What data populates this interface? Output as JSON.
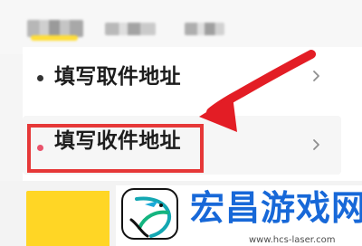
{
  "address_list": {
    "pickup_label": "填写取件地址",
    "delivery_label": "填写收件地址"
  },
  "watermark": {
    "brand": "宏昌游戏网",
    "url": "www.hcs-laser.com"
  },
  "colors": {
    "accent_yellow": "#ffd625",
    "highlight_red": "#e63838",
    "delivery_dot": "#e9536b",
    "watermark_blue": "#1768d8"
  },
  "icons": {
    "row_chevron": "chevron-right-icon",
    "annotation": "arrow-annotation-icon",
    "logo": "dragon-logo-icon"
  }
}
